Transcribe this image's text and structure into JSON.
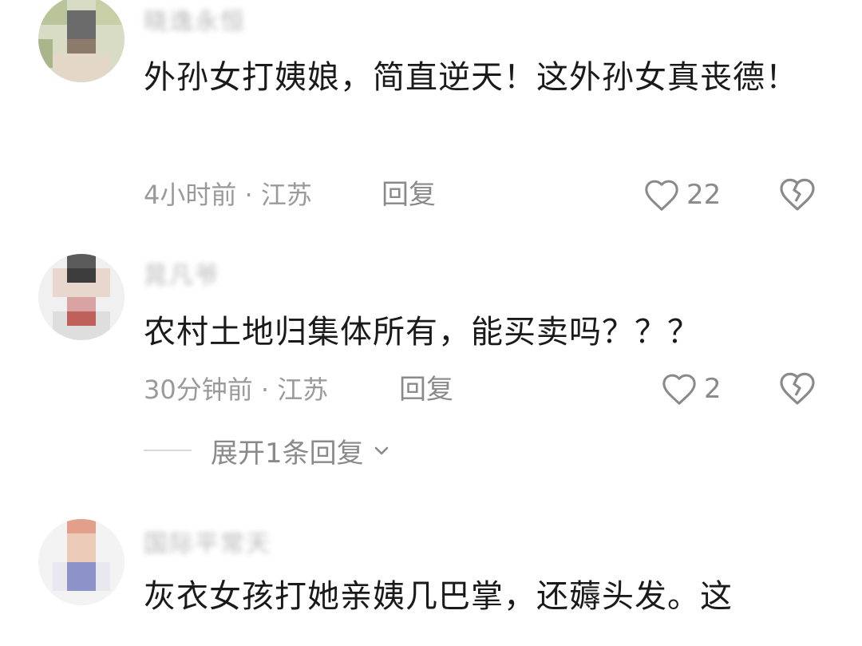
{
  "comments": [
    {
      "username": "晓逸永恒",
      "text": "外孙女打姨娘，简直逆天！这外孙女真丧德！",
      "meta": "4小时前 · 江苏",
      "reply_label": "回复",
      "likes": "22"
    },
    {
      "username": "晁凡爷",
      "text": "农村土地归集体所有，能买卖吗？？？",
      "meta": "30分钟前 · 江苏",
      "reply_label": "回复",
      "likes": "2",
      "expand_label": "展开1条回复"
    },
    {
      "username": "国际平常天",
      "text": "灰衣女孩打她亲姨几巴掌，还薅头发。这"
    }
  ],
  "icons": {
    "like": "heart-outline-icon",
    "dislike": "broken-heart-icon",
    "expand": "chevron-down-icon"
  },
  "colors": {
    "text": "#1a1a1a",
    "secondary": "#9a9a9a",
    "icon": "#8a8a8a"
  }
}
